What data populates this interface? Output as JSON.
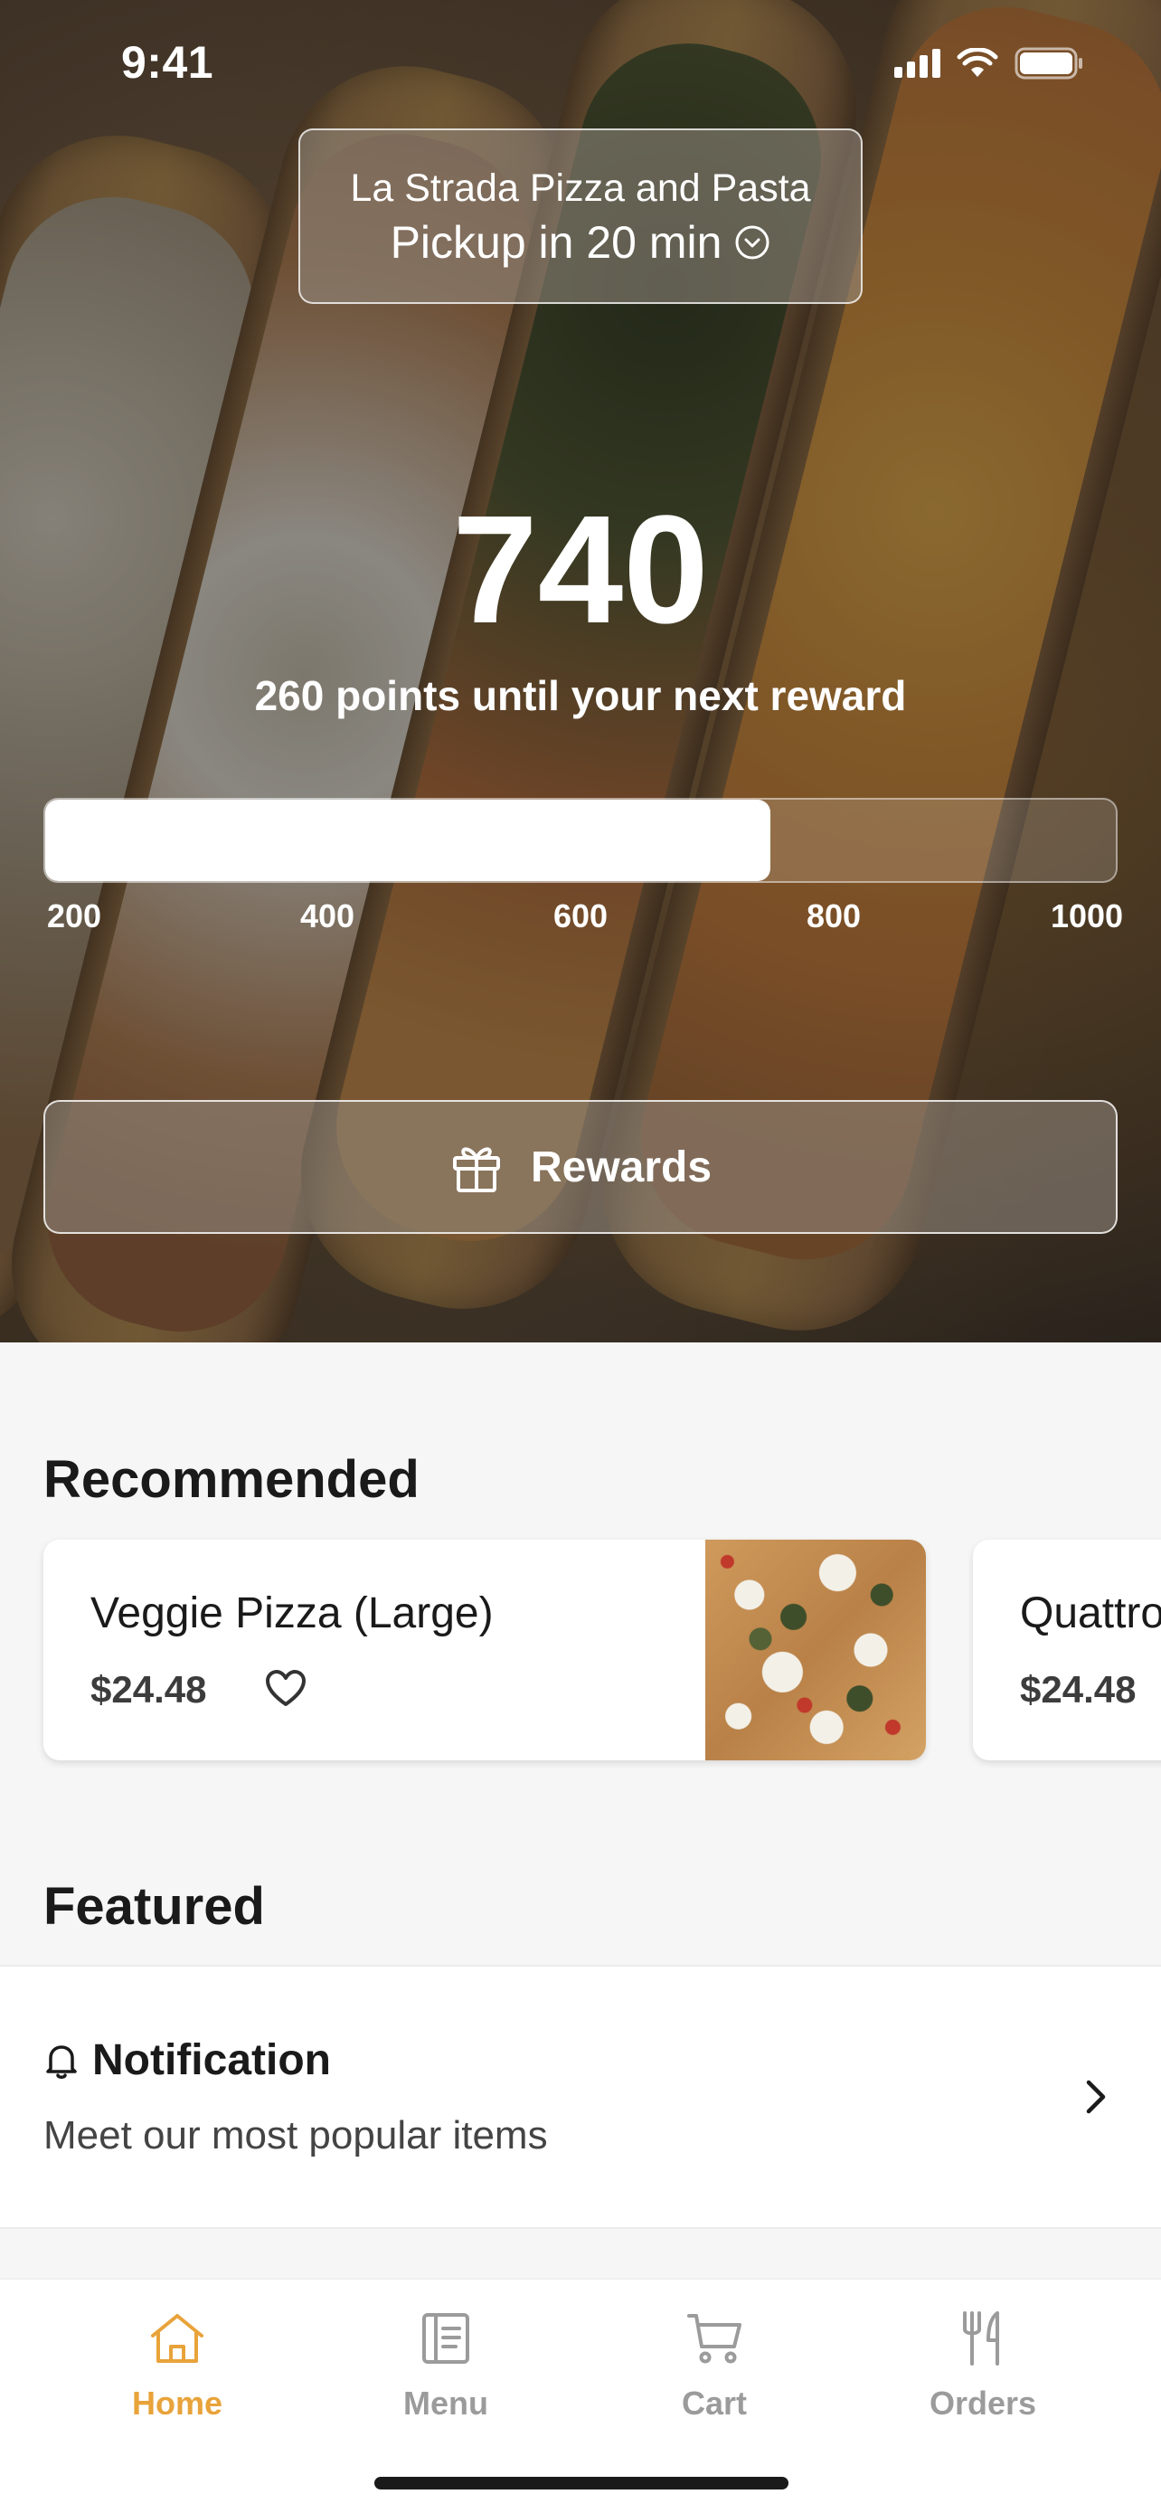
{
  "status_bar": {
    "time": "9:41"
  },
  "store": {
    "name": "La Strada Pizza and Pasta",
    "pickup_label": "Pickup in 20 min"
  },
  "loyalty": {
    "points": "740",
    "subtitle": "260 points until your next reward",
    "progress_value": 740,
    "progress_min": 200,
    "progress_max": 1000,
    "ticks": [
      "200",
      "400",
      "600",
      "800",
      "1000"
    ]
  },
  "rewards_button": {
    "label": "Rewards"
  },
  "recommended": {
    "title": "Recommended",
    "items": [
      {
        "name": "Veggie Pizza (Large)",
        "price": "$24.48"
      },
      {
        "name": "Quattro",
        "price": "$24.48"
      }
    ]
  },
  "featured": {
    "title": "Featured",
    "notification": {
      "title": "Notification",
      "body": "Meet our most popular items"
    }
  },
  "tabbar": {
    "items": [
      {
        "label": "Home"
      },
      {
        "label": "Menu"
      },
      {
        "label": "Cart"
      },
      {
        "label": "Orders"
      }
    ]
  },
  "colors": {
    "accent": "#e8a33a",
    "inactive_tab": "#9b9b9b",
    "background": "#f6f6f6"
  },
  "icons": {
    "status": [
      "cellular-signal-icon",
      "wifi-icon",
      "battery-icon"
    ],
    "store": "chevron-down-circle-icon",
    "rewards": "gift-icon",
    "card": "heart-icon",
    "notification": "bell-icon",
    "row": "chevron-right-icon",
    "tabs": [
      "home-icon",
      "menu-icon",
      "cart-icon",
      "orders-icon"
    ]
  }
}
